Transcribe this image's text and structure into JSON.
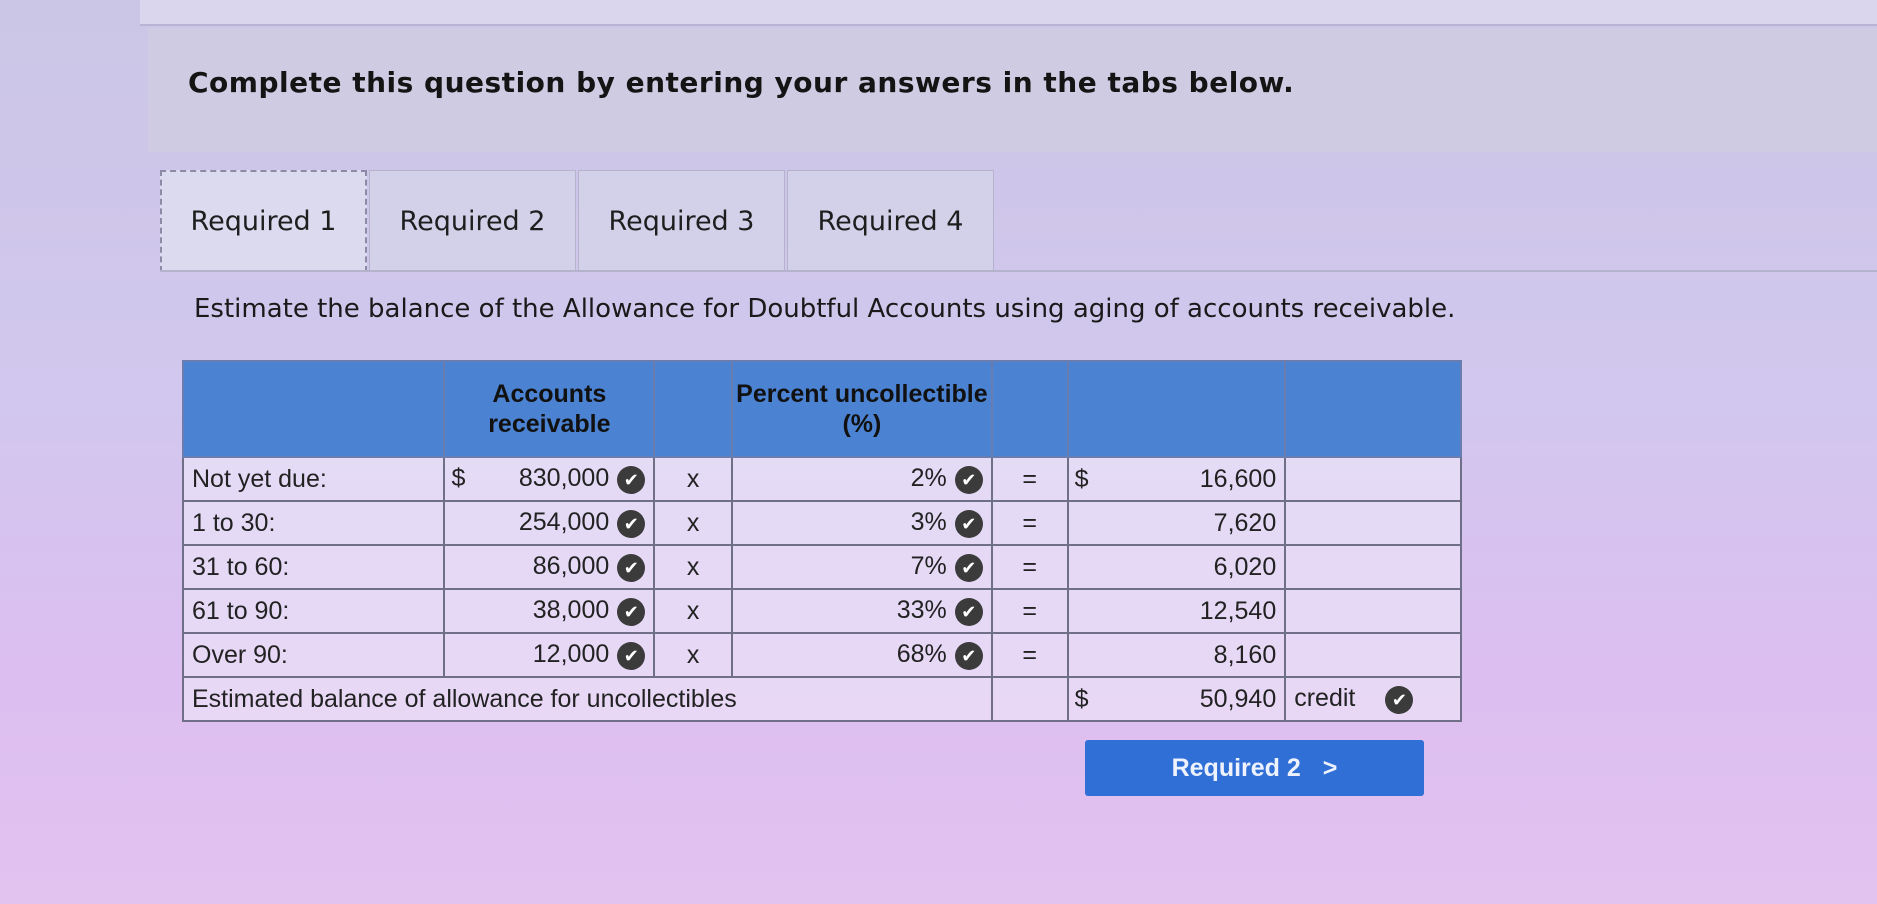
{
  "instruction": "Complete this question by entering your answers in the tabs below.",
  "tabs": [
    {
      "label": "Required 1",
      "active": true
    },
    {
      "label": "Required 2",
      "active": false
    },
    {
      "label": "Required 3",
      "active": false
    },
    {
      "label": "Required 4",
      "active": false
    }
  ],
  "subtitle": "Estimate the balance of the Allowance for Doubtful Accounts using aging of accounts receivable.",
  "table": {
    "headers": [
      "",
      "Accounts receivable",
      "",
      "Percent uncollectible (%)",
      "",
      "",
      ""
    ],
    "rows": [
      {
        "label": "Not yet due:",
        "ar_dollar": "$",
        "ar": "830,000",
        "op": "x",
        "pct": "2%",
        "eq": "=",
        "res_dollar": "$",
        "result": "16,600"
      },
      {
        "label": "1 to 30:",
        "ar_dollar": "",
        "ar": "254,000",
        "op": "x",
        "pct": "3%",
        "eq": "=",
        "res_dollar": "",
        "result": "7,620"
      },
      {
        "label": "31 to 60:",
        "ar_dollar": "",
        "ar": "86,000",
        "op": "x",
        "pct": "7%",
        "eq": "=",
        "res_dollar": "",
        "result": "6,020"
      },
      {
        "label": "61 to 90:",
        "ar_dollar": "",
        "ar": "38,000",
        "op": "x",
        "pct": "33%",
        "eq": "=",
        "res_dollar": "",
        "result": "12,540"
      },
      {
        "label": "Over 90:",
        "ar_dollar": "",
        "ar": "12,000",
        "op": "x",
        "pct": "68%",
        "eq": "=",
        "res_dollar": "",
        "result": "8,160"
      }
    ],
    "total": {
      "label": "Estimated balance of allowance for uncollectibles",
      "dollar": "$",
      "value": "50,940",
      "type": "credit"
    }
  },
  "next_button": {
    "label": "Required 2",
    "arrow": ">"
  },
  "check_mark": "✔"
}
